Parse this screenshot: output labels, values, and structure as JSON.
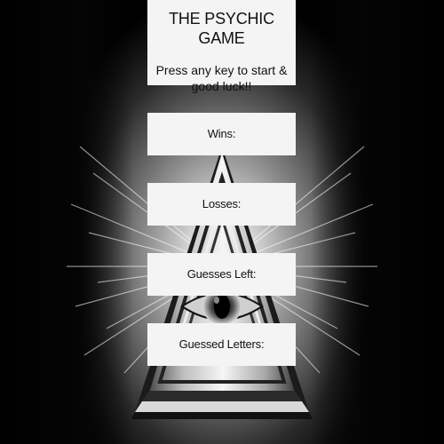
{
  "game": {
    "title": "THE PSYCHIC GAME",
    "instructions": "Press any key to start & good luck!!"
  },
  "stats": {
    "wins_label": "Wins:",
    "losses_label": "Losses:",
    "guesses_left_label": "Guesses Left:",
    "guessed_letters_label": "Guessed Letters:"
  },
  "background": {
    "icon": "all-seeing-eye-pyramid-icon"
  }
}
